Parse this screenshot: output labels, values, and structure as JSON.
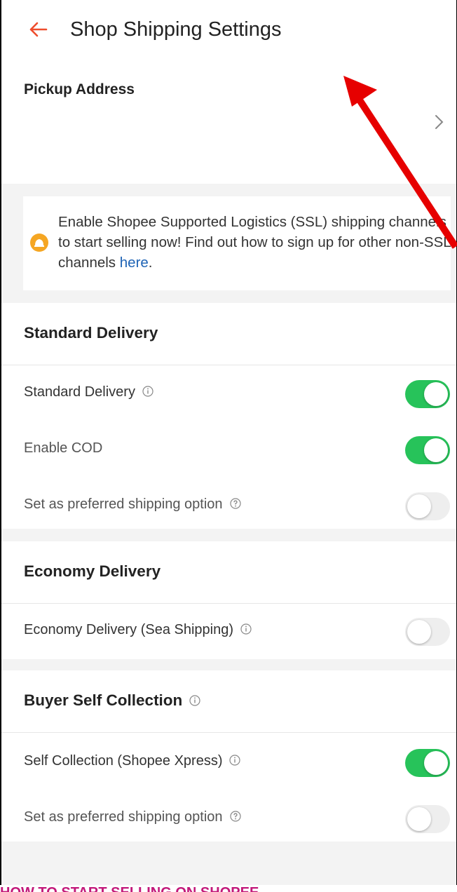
{
  "header": {
    "title": "Shop Shipping Settings"
  },
  "pickup": {
    "label": "Pickup Address"
  },
  "notice": {
    "text": "Enable Shopee Supported Logistics (SSL) shipping channels to start selling now! Find out how to sign up for other non-SSL channels ",
    "link": "here",
    "tail": "."
  },
  "sections": {
    "standard": {
      "title": "Standard Delivery",
      "rows": [
        {
          "label": "Standard Delivery",
          "toggle": "on"
        },
        {
          "label": "Enable COD",
          "toggle": "on"
        },
        {
          "label": "Set as preferred shipping option",
          "toggle": "off"
        }
      ]
    },
    "economy": {
      "title": "Economy Delivery",
      "rows": [
        {
          "label": "Economy Delivery (Sea Shipping)",
          "toggle": "off"
        }
      ]
    },
    "self_collection": {
      "title": "Buyer Self Collection",
      "rows": [
        {
          "label": "Self Collection (Shopee Xpress)",
          "toggle": "on"
        },
        {
          "label": "Set as preferred shipping option",
          "toggle": "off"
        }
      ]
    }
  },
  "footer": {
    "caption": "HOW TO START SELLING ON SHOPEE"
  },
  "colors": {
    "accent": "#ee4d2d",
    "toggle_on": "#27c35a",
    "link": "#1e63b5",
    "annotation": "#e60000",
    "caption": "#c2187a"
  }
}
